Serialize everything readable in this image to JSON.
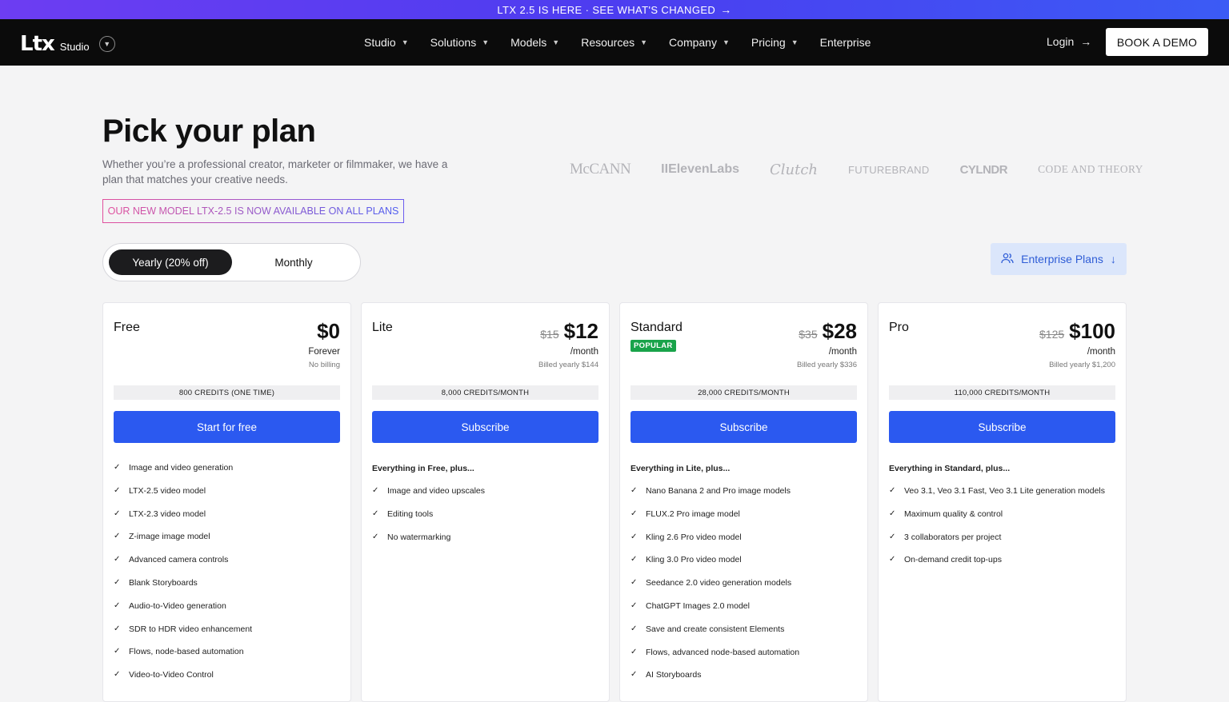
{
  "announcement": {
    "text": "LTX 2.5 IS HERE · SEE WHAT'S CHANGED",
    "arrow": "→"
  },
  "nav": {
    "logo_mark": "Ltx",
    "logo_sub": "Studio",
    "logo_toggle_icon": "chevron-down-icon",
    "items": [
      {
        "label": "Studio",
        "has_dropdown": true
      },
      {
        "label": "Solutions",
        "has_dropdown": true
      },
      {
        "label": "Models",
        "has_dropdown": true
      },
      {
        "label": "Resources",
        "has_dropdown": true
      },
      {
        "label": "Company",
        "has_dropdown": true
      },
      {
        "label": "Pricing",
        "has_dropdown": true
      },
      {
        "label": "Enterprise",
        "has_dropdown": false
      }
    ],
    "login_label": "Login",
    "demo_label": "BOOK A DEMO"
  },
  "hero": {
    "title": "Pick your plan",
    "subtitle": "Whether you’re a professional creator, marketer or filmmaker, we have a plan that matches your creative needs.",
    "banner": "OUR NEW MODEL LTX-2.5 IS NOW AVAILABLE ON ALL PLANS"
  },
  "brands": [
    "McCANN",
    "IIElevenLabs",
    "Clutch",
    "FUTUREBRAND",
    "CYLNDR",
    "CODE AND THEORY"
  ],
  "billing_toggle": {
    "yearly": "Yearly (20% off)",
    "monthly": "Monthly",
    "selected": "yearly"
  },
  "enterprise_button": {
    "label": "Enterprise Plans",
    "icon": "users-icon",
    "arrow_icon": "arrow-down-icon"
  },
  "colors": {
    "primary": "#2b59f0",
    "popular": "#19a34a",
    "enterprise_bg": "#dbe6fb",
    "nav_bg": "#0b0b0b"
  },
  "plans": [
    {
      "name": "Free",
      "badge": "",
      "old_price": "",
      "price": "$0",
      "period": "Forever",
      "billed": "No billing",
      "credits": "800 CREDITS (ONE TIME)",
      "cta": "Start for free",
      "heading": "",
      "features": [
        "Image and video generation",
        "LTX-2.5 video model",
        "LTX-2.3 video model",
        "Z-image image model",
        "Advanced camera controls",
        "Blank Storyboards",
        "Audio-to-Video generation",
        "SDR to HDR video enhancement",
        "Flows, node-based automation",
        "Video-to-Video Control"
      ]
    },
    {
      "name": "Lite",
      "badge": "",
      "old_price": "$15",
      "price": "$12",
      "period": "/month",
      "billed": "Billed yearly $144",
      "credits": "8,000 CREDITS/MONTH",
      "cta": "Subscribe",
      "heading": "Everything in Free, plus...",
      "features": [
        "Image and video upscales",
        "Editing tools",
        "No watermarking"
      ]
    },
    {
      "name": "Standard",
      "badge": "POPULAR",
      "old_price": "$35",
      "price": "$28",
      "period": "/month",
      "billed": "Billed yearly $336",
      "credits": "28,000 CREDITS/MONTH",
      "cta": "Subscribe",
      "heading": "Everything in Lite, plus...",
      "features": [
        "Nano Banana 2 and Pro image models",
        "FLUX.2 Pro image model",
        "Kling 2.6 Pro video model",
        "Kling 3.0 Pro video model",
        "Seedance 2.0 video generation models",
        "ChatGPT Images 2.0 model",
        "Save and create consistent Elements",
        "Flows, advanced node-based automation",
        "AI Storyboards"
      ]
    },
    {
      "name": "Pro",
      "badge": "",
      "old_price": "$125",
      "price": "$100",
      "period": "/month",
      "billed": "Billed yearly $1,200",
      "credits": "110,000 CREDITS/MONTH",
      "cta": "Subscribe",
      "heading": "Everything in Standard, plus...",
      "features": [
        "Veo 3.1, Veo 3.1 Fast, Veo 3.1 Lite generation models",
        "Maximum quality & control",
        "3 collaborators per project",
        "On-demand credit top-ups"
      ]
    }
  ]
}
